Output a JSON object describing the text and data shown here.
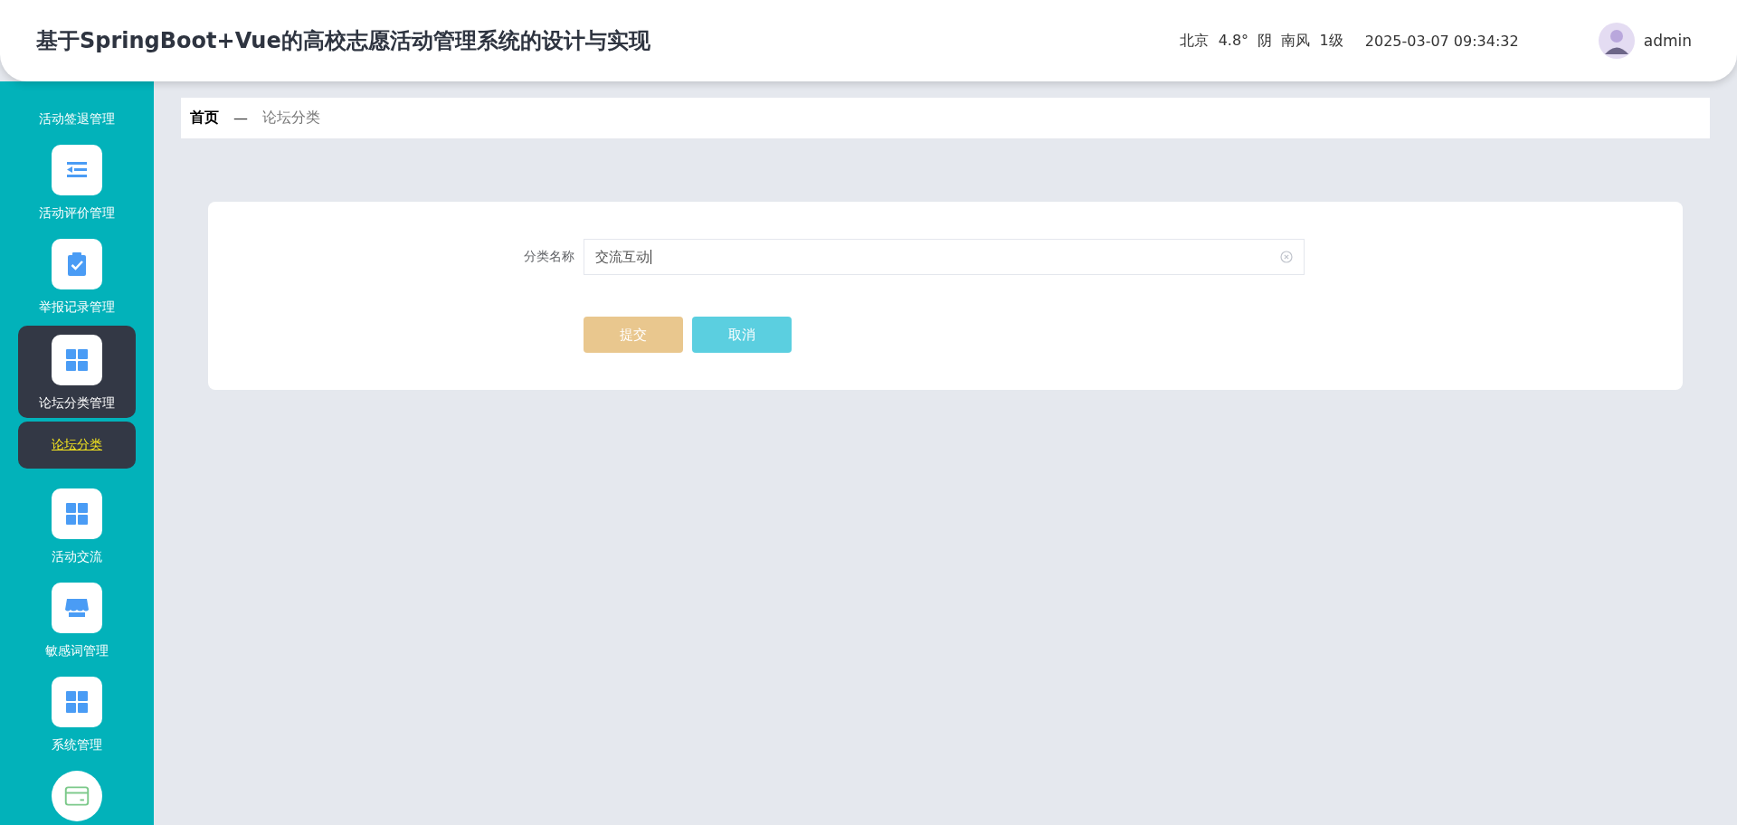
{
  "header": {
    "title": "基于SpringBoot+Vue的高校志愿活动管理系统的设计与实现",
    "weather": "北京  4.8°  阴  南风  1级",
    "datetime": "2025-03-07 09:34:32",
    "user": "admin"
  },
  "sidebar": {
    "items": [
      {
        "label": "活动签退管理",
        "kind": "text",
        "selected": false
      },
      {
        "label": "活动评价管理",
        "kind": "list",
        "selected": false
      },
      {
        "label": "举报记录管理",
        "kind": "clipboard",
        "selected": false
      },
      {
        "label": "论坛分类管理",
        "kind": "grid",
        "selected": true,
        "children": [
          {
            "label": "论坛分类",
            "selected": true
          }
        ]
      },
      {
        "label": "活动交流",
        "kind": "grid",
        "selected": false
      },
      {
        "label": "敏感词管理",
        "kind": "shop",
        "selected": false
      },
      {
        "label": "系统管理",
        "kind": "grid",
        "selected": false
      },
      {
        "kind": "card",
        "selected": false
      }
    ]
  },
  "breadcrumb": [
    {
      "label": "首页",
      "kind": "home"
    },
    {
      "label": "—",
      "kind": "separator"
    },
    {
      "label": "论坛分类",
      "kind": "current"
    }
  ],
  "form": {
    "fields": [
      {
        "label": "分类名称",
        "value": "交流互动"
      }
    ],
    "buttons": [
      {
        "label": "提交",
        "kind": "submit"
      },
      {
        "label": "取消",
        "kind": "cancel"
      }
    ]
  }
}
